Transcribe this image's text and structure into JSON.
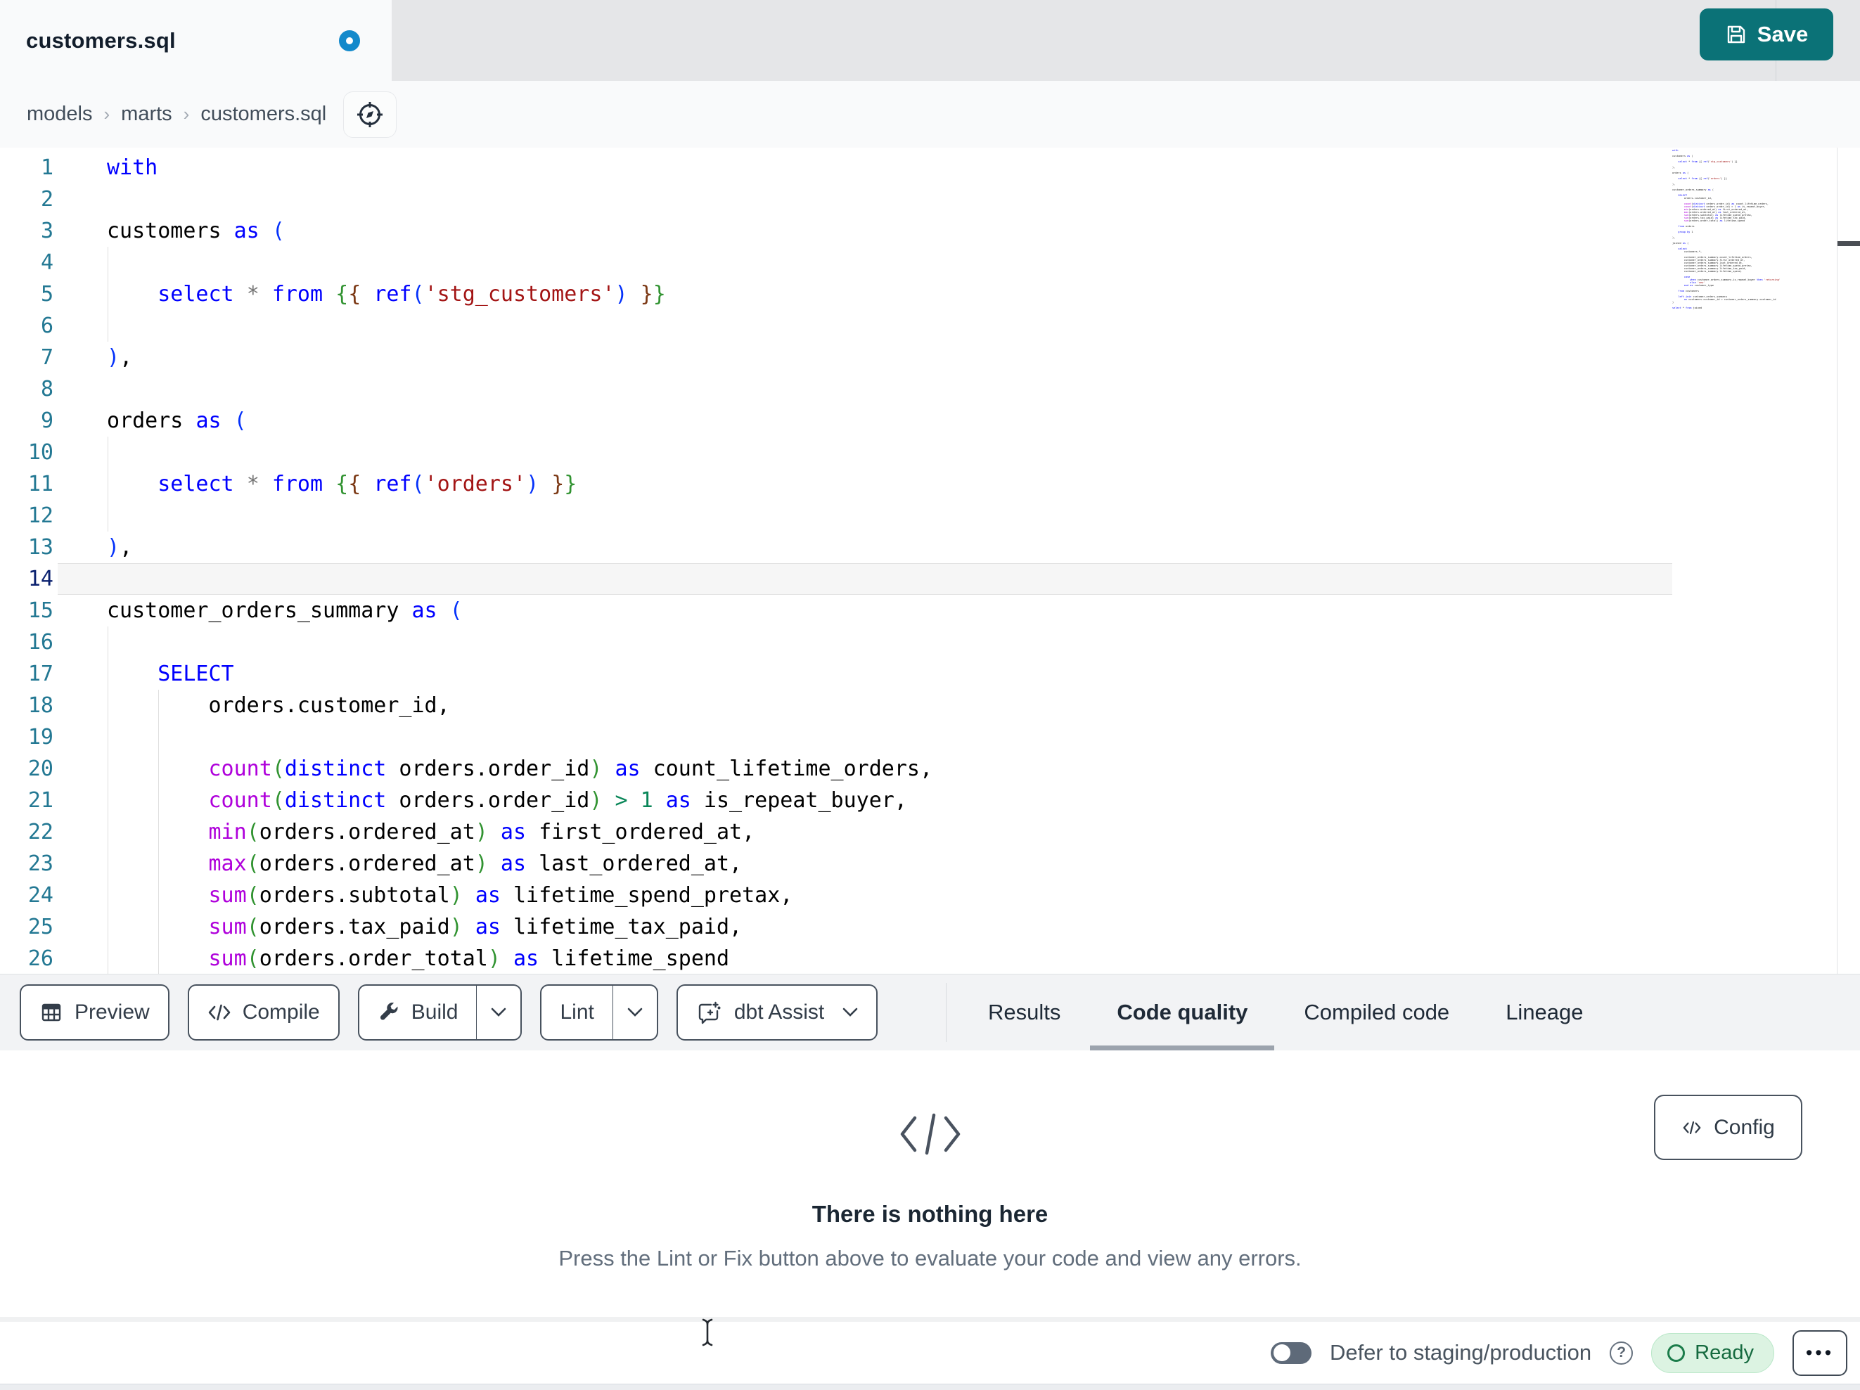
{
  "tab_bar": {
    "active_tab": "customers.sql",
    "new_tab_button": "+"
  },
  "breadcrumb": {
    "items": [
      "models",
      "marts",
      "customers.sql"
    ],
    "separator": "›"
  },
  "actions": {
    "save": "Save"
  },
  "editor": {
    "active_line": 14,
    "lines": [
      {
        "n": 1,
        "g": 0,
        "t": [
          [
            "kw",
            "with"
          ]
        ]
      },
      {
        "n": 2,
        "g": 0,
        "t": []
      },
      {
        "n": 3,
        "g": 0,
        "t": [
          [
            "txt",
            "customers "
          ],
          [
            "kw",
            "as"
          ],
          [
            "txt",
            " "
          ],
          [
            "b1",
            "("
          ]
        ]
      },
      {
        "n": 4,
        "g": 1,
        "t": []
      },
      {
        "n": 5,
        "g": 1,
        "t": [
          [
            "txt",
            "    "
          ],
          [
            "kw",
            "select"
          ],
          [
            "txt",
            " "
          ],
          [
            "op",
            "*"
          ],
          [
            "txt",
            " "
          ],
          [
            "kw",
            "from"
          ],
          [
            "txt",
            " "
          ],
          [
            "b2",
            "{"
          ],
          [
            "b3",
            "{"
          ],
          [
            "txt",
            " "
          ],
          [
            "kw",
            "ref"
          ],
          [
            "b1",
            "("
          ],
          [
            "str",
            "'stg_customers'"
          ],
          [
            "b1",
            ")"
          ],
          [
            "txt",
            " "
          ],
          [
            "b3",
            "}"
          ],
          [
            "b2",
            "}"
          ]
        ]
      },
      {
        "n": 6,
        "g": 1,
        "t": []
      },
      {
        "n": 7,
        "g": 0,
        "t": [
          [
            "b1",
            ")"
          ],
          [
            "txt",
            ","
          ]
        ]
      },
      {
        "n": 8,
        "g": 0,
        "t": []
      },
      {
        "n": 9,
        "g": 0,
        "t": [
          [
            "txt",
            "orders "
          ],
          [
            "kw",
            "as"
          ],
          [
            "txt",
            " "
          ],
          [
            "b1",
            "("
          ]
        ]
      },
      {
        "n": 10,
        "g": 1,
        "t": []
      },
      {
        "n": 11,
        "g": 1,
        "t": [
          [
            "txt",
            "    "
          ],
          [
            "kw",
            "select"
          ],
          [
            "txt",
            " "
          ],
          [
            "op",
            "*"
          ],
          [
            "txt",
            " "
          ],
          [
            "kw",
            "from"
          ],
          [
            "txt",
            " "
          ],
          [
            "b2",
            "{"
          ],
          [
            "b3",
            "{"
          ],
          [
            "txt",
            " "
          ],
          [
            "kw",
            "ref"
          ],
          [
            "b1",
            "("
          ],
          [
            "str",
            "'orders'"
          ],
          [
            "b1",
            ")"
          ],
          [
            "txt",
            " "
          ],
          [
            "b3",
            "}"
          ],
          [
            "b2",
            "}"
          ]
        ]
      },
      {
        "n": 12,
        "g": 1,
        "t": []
      },
      {
        "n": 13,
        "g": 0,
        "t": [
          [
            "b1",
            ")"
          ],
          [
            "txt",
            ","
          ]
        ]
      },
      {
        "n": 14,
        "g": 0,
        "t": []
      },
      {
        "n": 15,
        "g": 0,
        "t": [
          [
            "txt",
            "customer_orders_summary "
          ],
          [
            "kw",
            "as"
          ],
          [
            "txt",
            " "
          ],
          [
            "b1",
            "("
          ]
        ]
      },
      {
        "n": 16,
        "g": 1,
        "t": []
      },
      {
        "n": 17,
        "g": 1,
        "t": [
          [
            "txt",
            "    "
          ],
          [
            "kw",
            "SELECT"
          ]
        ]
      },
      {
        "n": 18,
        "g": 2,
        "t": [
          [
            "txt",
            "        orders.customer_id,"
          ]
        ]
      },
      {
        "n": 19,
        "g": 2,
        "t": []
      },
      {
        "n": 20,
        "g": 2,
        "t": [
          [
            "txt",
            "        "
          ],
          [
            "fn",
            "count"
          ],
          [
            "b2",
            "("
          ],
          [
            "kw",
            "distinct"
          ],
          [
            "txt",
            " orders.order_id"
          ],
          [
            "b2",
            ")"
          ],
          [
            "txt",
            " "
          ],
          [
            "kw",
            "as"
          ],
          [
            "txt",
            " count_lifetime_orders,"
          ]
        ]
      },
      {
        "n": 21,
        "g": 2,
        "t": [
          [
            "txt",
            "        "
          ],
          [
            "fn",
            "count"
          ],
          [
            "b2",
            "("
          ],
          [
            "kw",
            "distinct"
          ],
          [
            "txt",
            " orders.order_id"
          ],
          [
            "b2",
            ")"
          ],
          [
            "txt",
            " "
          ],
          [
            "num",
            "> 1"
          ],
          [
            "txt",
            " "
          ],
          [
            "kw",
            "as"
          ],
          [
            "txt",
            " is_repeat_buyer,"
          ]
        ]
      },
      {
        "n": 22,
        "g": 2,
        "t": [
          [
            "txt",
            "        "
          ],
          [
            "fn",
            "min"
          ],
          [
            "b2",
            "("
          ],
          [
            "txt",
            "orders.ordered_at"
          ],
          [
            "b2",
            ")"
          ],
          [
            "txt",
            " "
          ],
          [
            "kw",
            "as"
          ],
          [
            "txt",
            " first_ordered_at,"
          ]
        ]
      },
      {
        "n": 23,
        "g": 2,
        "t": [
          [
            "txt",
            "        "
          ],
          [
            "fn",
            "max"
          ],
          [
            "b2",
            "("
          ],
          [
            "txt",
            "orders.ordered_at"
          ],
          [
            "b2",
            ")"
          ],
          [
            "txt",
            " "
          ],
          [
            "kw",
            "as"
          ],
          [
            "txt",
            " last_ordered_at,"
          ]
        ]
      },
      {
        "n": 24,
        "g": 2,
        "t": [
          [
            "txt",
            "        "
          ],
          [
            "fn",
            "sum"
          ],
          [
            "b2",
            "("
          ],
          [
            "txt",
            "orders.subtotal"
          ],
          [
            "b2",
            ")"
          ],
          [
            "txt",
            " "
          ],
          [
            "kw",
            "as"
          ],
          [
            "txt",
            " lifetime_spend_pretax,"
          ]
        ]
      },
      {
        "n": 25,
        "g": 2,
        "t": [
          [
            "txt",
            "        "
          ],
          [
            "fn",
            "sum"
          ],
          [
            "b2",
            "("
          ],
          [
            "txt",
            "orders.tax_paid"
          ],
          [
            "b2",
            ")"
          ],
          [
            "txt",
            " "
          ],
          [
            "kw",
            "as"
          ],
          [
            "txt",
            " lifetime_tax_paid,"
          ]
        ]
      },
      {
        "n": 26,
        "g": 2,
        "t": [
          [
            "txt",
            "        "
          ],
          [
            "fn",
            "sum"
          ],
          [
            "b2",
            "("
          ],
          [
            "txt",
            "orders.order_total"
          ],
          [
            "b2",
            ")"
          ],
          [
            "txt",
            " "
          ],
          [
            "kw",
            "as"
          ],
          [
            "txt",
            " lifetime_spend"
          ]
        ]
      }
    ]
  },
  "minimap": {
    "lines": [
      "with",
      "",
      "customers as (",
      "",
      "    select * from {{ ref('stg_customers') }}",
      "",
      "),",
      "",
      "orders as (",
      "",
      "    select * from {{ ref('orders') }}",
      "",
      "),",
      "",
      "customer_orders_summary as (",
      "",
      "    SELECT",
      "        orders.customer_id,",
      "",
      "        count(distinct orders.order_id) as count_lifetime_orders,",
      "        count(distinct orders.order_id) > 1 as is_repeat_buyer,",
      "        min(orders.ordered_at) as first_ordered_at,",
      "        max(orders.ordered_at) as last_ordered_at,",
      "        sum(orders.subtotal) as lifetime_spend_pretax,",
      "        sum(orders.tax_paid) as lifetime_tax_paid,",
      "        sum(orders.order_total) as lifetime_spend",
      "",
      "    from orders",
      "",
      "    group by 1",
      "",
      "),",
      "",
      "joined as (",
      "",
      "    select",
      "        customers.*,",
      "",
      "        customer_orders_summary.count_lifetime_orders,",
      "        customer_orders_summary.first_ordered_at,",
      "        customer_orders_summary.last_ordered_at,",
      "        customer_orders_summary.lifetime_spend_pretax,",
      "        customer_orders_summary.lifetime_tax_paid,",
      "        customer_orders_summary.lifetime_spend,",
      "",
      "        case",
      "            when customer_orders_summary.is_repeat_buyer then 'returning'",
      "            else 'new'",
      "        end as customer_type",
      "",
      "    from customers",
      "",
      "    left join customer_orders_summary",
      "        on customers.customer_id = customer_orders_summary.customer_id",
      ")",
      "",
      "select * from joined"
    ]
  },
  "toolbar": {
    "preview": "Preview",
    "compile": "Compile",
    "build": "Build",
    "lint": "Lint",
    "assist": "dbt Assist"
  },
  "panel": {
    "tabs": [
      {
        "label": "Results"
      },
      {
        "label": "Code quality"
      },
      {
        "label": "Compiled code"
      },
      {
        "label": "Lineage"
      }
    ],
    "config": "Config",
    "empty": {
      "title": "There is nothing here",
      "subtitle": "Press the Lint or Fix button above to evaluate your code and view any errors."
    }
  },
  "status_bar": {
    "defer": "Defer to staging/production",
    "ready": "Ready",
    "more": "•••"
  },
  "colors": {
    "save_teal": "#0B7277",
    "modified_dot_blue": "#1389CB",
    "tabbar_gray": "#E5E6E8",
    "ready_bg": "#DCF3E2",
    "ready_text": "#156A3F",
    "active_tab_underline": "#9CA3AD",
    "syntax_keyword": "#0000FF",
    "syntax_function": "#AF00DB",
    "syntax_string": "#A31515",
    "syntax_number": "#098658",
    "bracket_1": "#0431FA",
    "bracket_2": "#319331",
    "bracket_3": "#7B3814",
    "line_number": "#237893",
    "line_number_active": "#0B216F"
  }
}
